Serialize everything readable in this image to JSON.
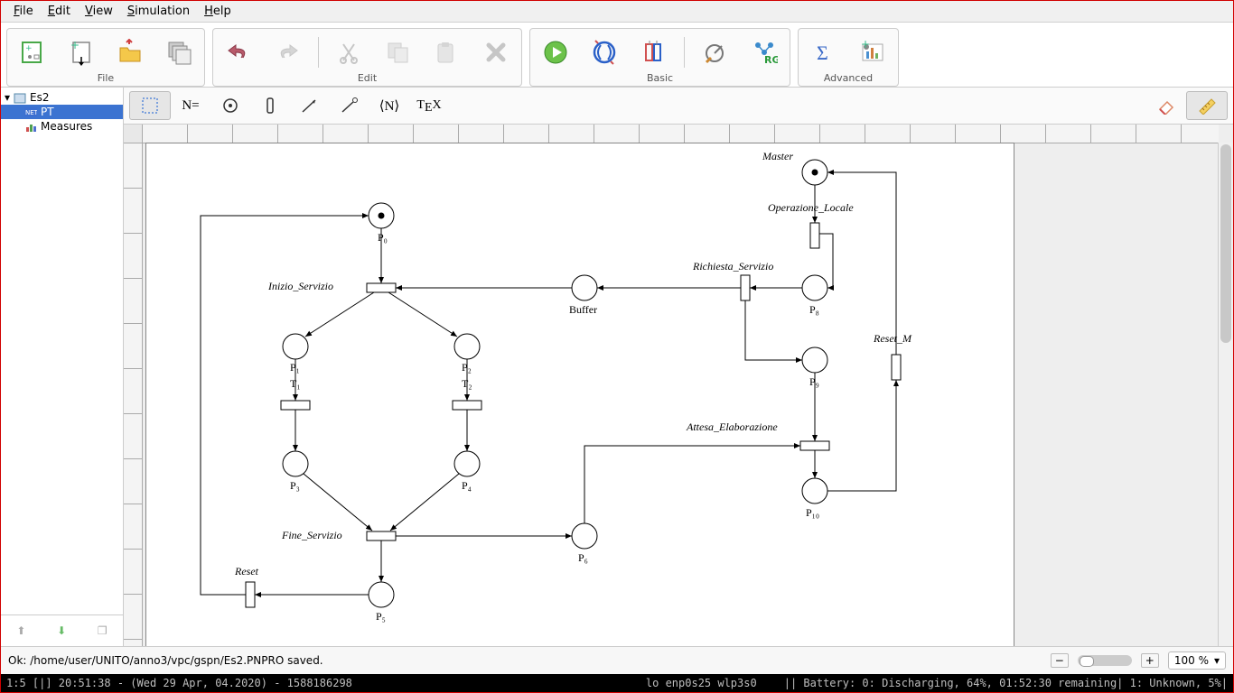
{
  "menu": {
    "file": "File",
    "edit": "Edit",
    "view": "View",
    "simulation": "Simulation",
    "help": "Help"
  },
  "toolbar_groups": {
    "file": "File",
    "edit": "Edit",
    "basic": "Basic",
    "advanced": "Advanced"
  },
  "editbar": {
    "neq": "N=",
    "nbrackets": "⟨N⟩",
    "tex": "TEX"
  },
  "tree": {
    "root": "Es2",
    "pt": "PT",
    "measures": "Measures"
  },
  "status": {
    "msg": "Ok: /home/user/UNITO/anno3/vpc/gspn/Es2.PNPRO saved.",
    "zoom": "100 %"
  },
  "sysbar": {
    "left": "1:5 [|]   20:51:38 - (Wed 29 Apr, 04.2020) - 1588186298",
    "mid": "lo enp0s25 wlp3s0",
    "right": "||   Battery: 0: Discharging, 64%, 01:52:30 remaining| 1: Unknown, 5%|"
  },
  "net": {
    "labels": {
      "master": "Master",
      "op_locale": "Operazione_Locale",
      "rich_serv": "Richiesta_Servizio",
      "reset_m": "Reset_M",
      "attesa": "Attesa_Elaborazione",
      "inizio": "Inizio_Servizio",
      "fine": "Fine_Servizio",
      "reset": "Reset",
      "buffer": "Buffer"
    },
    "places": {
      "p0": "P₀",
      "p1": "P₁",
      "p2": "P₂",
      "p3": "P₃",
      "p4": "P₄",
      "p5": "P₅",
      "p6": "P₆",
      "p8": "P₈",
      "p9": "P₉",
      "p10": "P₁₀"
    },
    "trans_small": {
      "t1": "T₁",
      "t2": "T₂"
    }
  }
}
